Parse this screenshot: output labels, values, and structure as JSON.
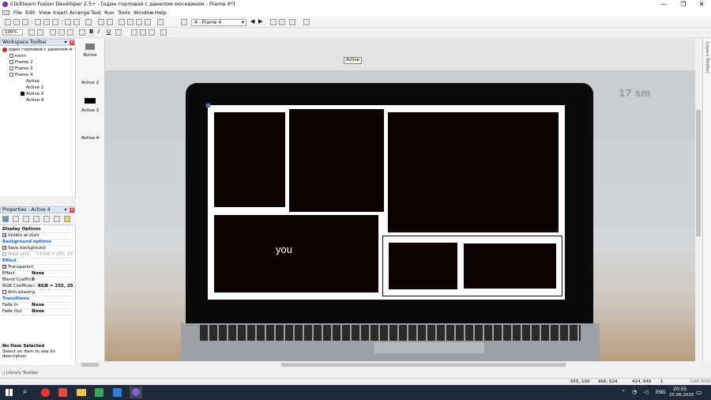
{
  "window": {
    "title": "Clickteam Fusion Developer 2.5+ - [один горловой с данилом москвином - Frame 4*]",
    "minimize": "—",
    "maximize": "❐",
    "close": "✕"
  },
  "menu": {
    "items": [
      "File",
      "Edit",
      "View",
      "Insert",
      "Arrange",
      "Text",
      "Run",
      "Tools",
      "Window",
      "Help"
    ]
  },
  "toolbar": {
    "frame_select": "4 - Frame 4",
    "zoom": "100%",
    "bold": "B",
    "italic": "I",
    "underline": "U"
  },
  "workspace": {
    "title": "Workspace Toolbar",
    "root": "один горловой с данилом м",
    "items": [
      "калл",
      "Frame 2",
      "Frame 3",
      "Frame 4"
    ],
    "children": [
      "Active",
      "Active 2",
      "Active 3",
      "Active 4"
    ]
  },
  "properties": {
    "title": "Properties - Active 4",
    "display_options": "Display Options",
    "visible_at_start": "Visible at start",
    "background_options": "Background options",
    "save_background": "Save background",
    "wipe_with": "Wipe with",
    "wipe_value": "RGB = 255, 255,",
    "effect_cat": "Effect",
    "transparent": "Transparent",
    "effect_label": "Effect",
    "effect_value": "None",
    "blend_label": "Blend Coeffic",
    "blend_value": "0",
    "rgb_label": "RGB Coefficie",
    "rgb_value": "RGB = 255, 255,",
    "anti_aliasing": "Anti-aliasing",
    "transitions": "Transitions",
    "fade_in": "Fade In",
    "fade_in_value": "None",
    "fade_out": "Fade Out",
    "fade_out_value": "None",
    "no_item": "No Item Selected",
    "select_hint": "Select an item to see its description"
  },
  "library_tab": "Library Toolbar",
  "layers_tab": "Layers Toolbar",
  "object_list": [
    "Active",
    "Active 2",
    "Active 3",
    "Active 4"
  ],
  "editor": {
    "tooltip_label": "Active",
    "watermark": "17 sm",
    "you_text": "you"
  },
  "status": {
    "cursor": "555, 100",
    "size": "966, 524",
    "coords2": "414, 649",
    "layer": "1",
    "caps": "CAP NUM"
  },
  "taskbar": {
    "lang": "ENG",
    "time": "20:05",
    "date": "25.06.2025"
  },
  "colors": {
    "accent": "#1a5fb4",
    "taskbar": "#1f2b3a"
  }
}
